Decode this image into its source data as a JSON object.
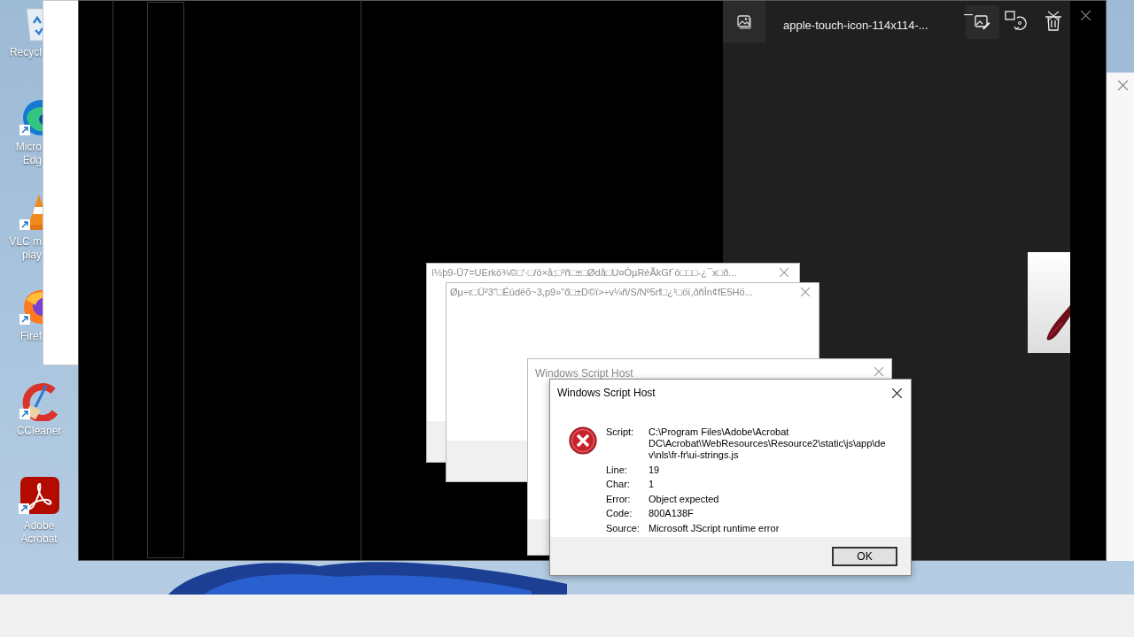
{
  "desktop": {
    "icons": [
      {
        "kind": "recycle",
        "label_lines": [
          "Recycl"
        ]
      },
      {
        "kind": "edge",
        "label_lines": [
          "Micro",
          "Edg"
        ]
      },
      {
        "kind": "vlc",
        "label_lines": [
          "VLC m",
          "play"
        ]
      },
      {
        "kind": "firefox",
        "label_lines": [
          "Firef"
        ]
      },
      {
        "kind": "ccleaner",
        "label_lines": [
          "CCleaner"
        ]
      },
      {
        "kind": "acrobat",
        "label_lines": [
          "Adobe",
          "Acrobat"
        ]
      }
    ]
  },
  "photos_viewer": {
    "title": "apple-touch-icon-114x114-..."
  },
  "background_dialogs": [
    {
      "title": "í½þ9-Ü7=UErkö¾©□'·□/ò×å;□²ñ□±□Ødå□U¤ÒµRéÃkGf`ö□□□-¿¯x□ð..."
    },
    {
      "title": "Øµ÷r□Ü²3\"□Éúdëõ~3,p9»\"ő□±D©ï>÷v¼ñ/S/Nº5rf□¿¹□öï,ðñÎn¢fE5Hö..."
    }
  ],
  "inactive_dialog": {
    "title": "Windows Script Host"
  },
  "error_dialog": {
    "title": "Windows Script Host",
    "fields": [
      {
        "label": "Script:",
        "value": "C:\\Program Files\\Adobe\\Acrobat DC\\Acrobat\\WebResources\\Resource2\\static\\js\\app\\dev\\nls\\fr-fr\\ui-strings.js"
      },
      {
        "label": "Line:",
        "value": "19"
      },
      {
        "label": "Char:",
        "value": "1"
      },
      {
        "label": "Error:",
        "value": "Object expected"
      },
      {
        "label": "Code:",
        "value": "800A138F"
      },
      {
        "label": "Source:",
        "value": "Microsoft JScript runtime error"
      }
    ],
    "buttons": [
      "OK"
    ]
  }
}
